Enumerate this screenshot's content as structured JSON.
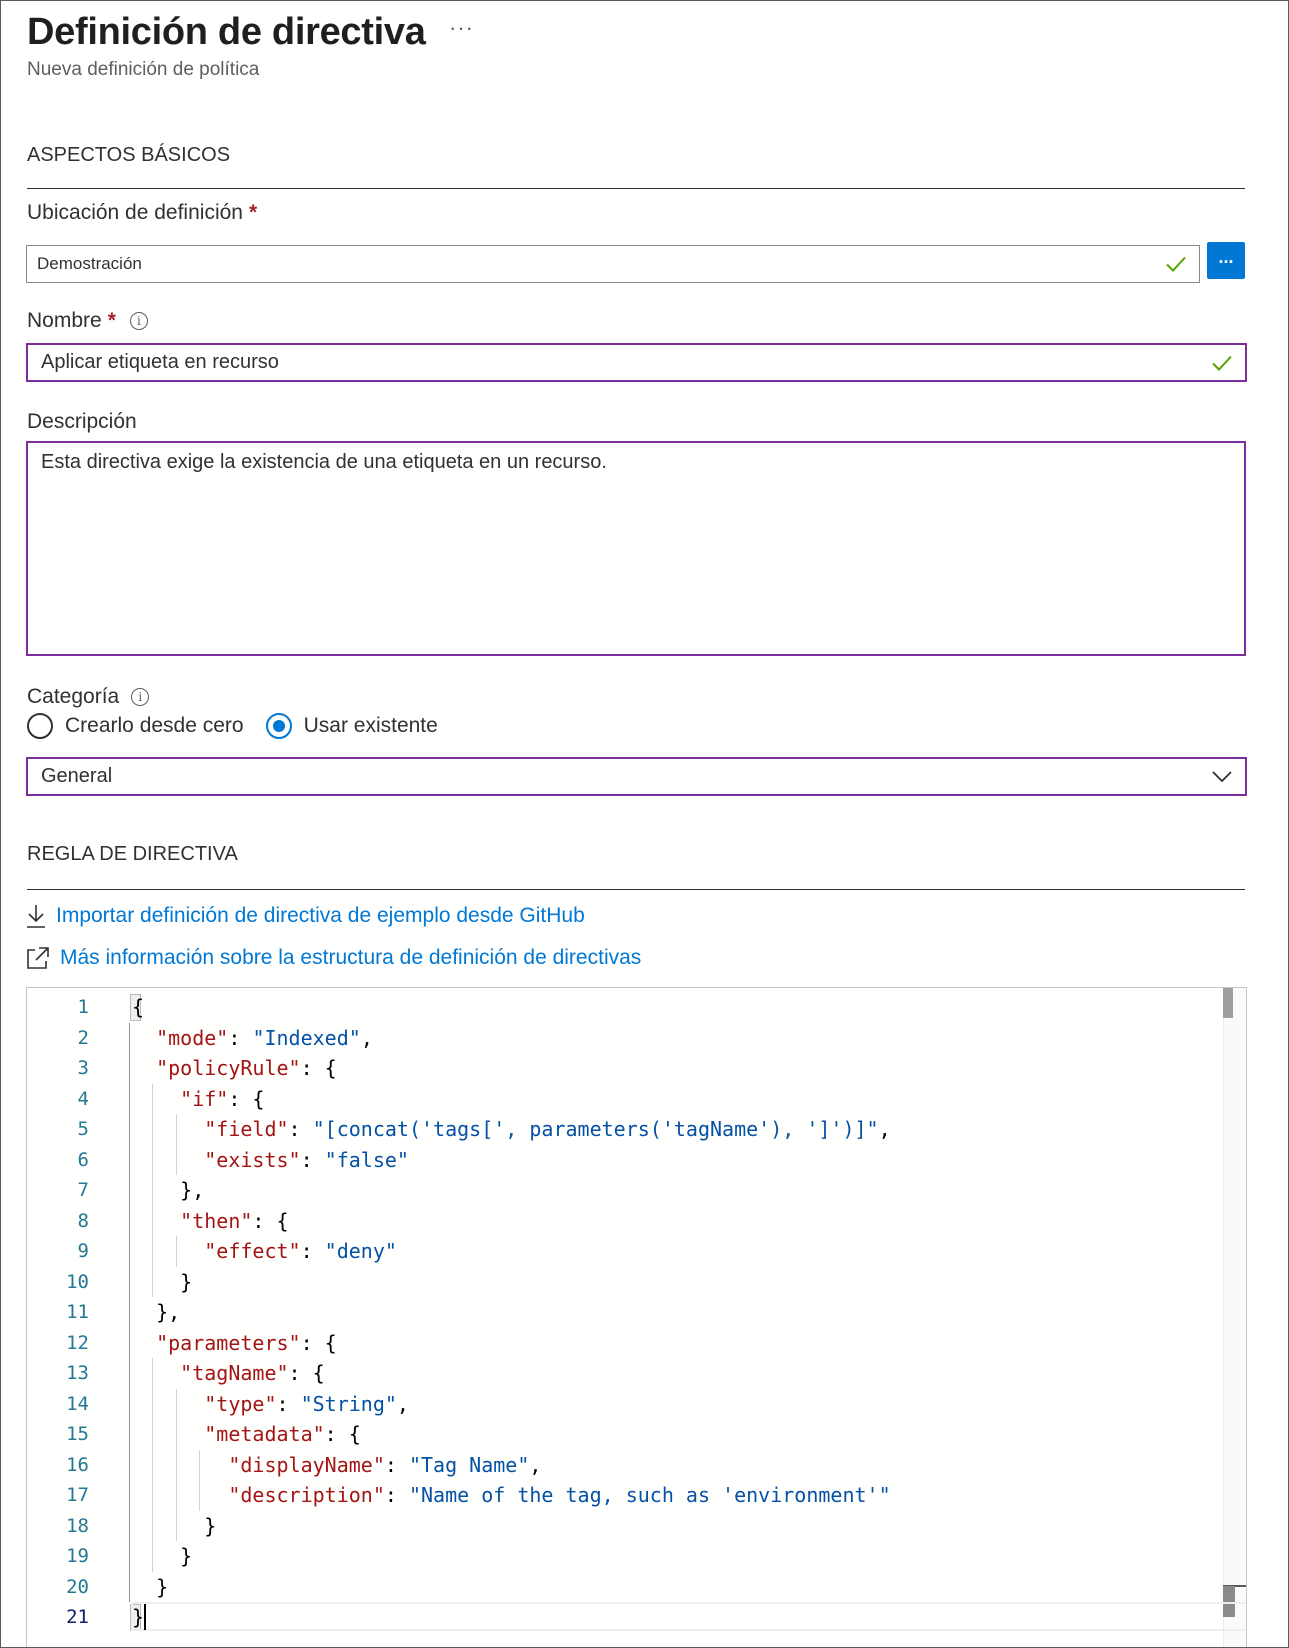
{
  "header": {
    "title": "Definición de directiva",
    "more_label": "···",
    "subtitle": "Nueva definición de política"
  },
  "basics": {
    "section_title": "ASPECTOS BÁSICOS",
    "location": {
      "label": "Ubicación de definición",
      "required_mark": "*",
      "value": "Demostración",
      "browse_label": "..."
    },
    "name": {
      "label": "Nombre",
      "required_mark": "*",
      "value": "Aplicar etiqueta en recurso"
    },
    "description": {
      "label": "Descripción",
      "value": "Esta directiva exige la existencia de una etiqueta en un recurso."
    },
    "category": {
      "label": "Categoría",
      "options": [
        {
          "label": "Crearlo desde cero",
          "selected": false
        },
        {
          "label": "Usar existente",
          "selected": true
        }
      ],
      "selected_value": "General"
    }
  },
  "policy_rule": {
    "section_title": "REGLA DE DIRECTIVA",
    "import_link": "Importar definición de directiva de ejemplo desde GitHub",
    "learn_more_link": "Más información sobre la estructura de definición de directivas",
    "current_line": 21,
    "code_lines": [
      "{",
      "  \"mode\": \"Indexed\",",
      "  \"policyRule\": {",
      "    \"if\": {",
      "      \"field\": \"[concat('tags[', parameters('tagName'), ']')]\",",
      "      \"exists\": \"false\"",
      "    },",
      "    \"then\": {",
      "      \"effect\": \"deny\"",
      "    }",
      "  },",
      "  \"parameters\": {",
      "    \"tagName\": {",
      "      \"type\": \"String\",",
      "      \"metadata\": {",
      "        \"displayName\": \"Tag Name\",",
      "        \"description\": \"Name of the tag, such as 'environment'\"",
      "      }",
      "    }",
      "  }",
      "}"
    ]
  },
  "colors": {
    "accent": "#0078d4",
    "focus_border": "#7a2d9b",
    "required": "#a4262c",
    "valid_check": "#57a300",
    "json_key": "#a31515",
    "json_string": "#0451a5",
    "line_number": "#237893"
  },
  "icons": {
    "valid": "checkmark-icon",
    "info": "info-icon",
    "dropdown": "chevron-down-icon",
    "import": "download-icon",
    "learn_more": "open-external-icon",
    "more": "more-options-icon"
  }
}
